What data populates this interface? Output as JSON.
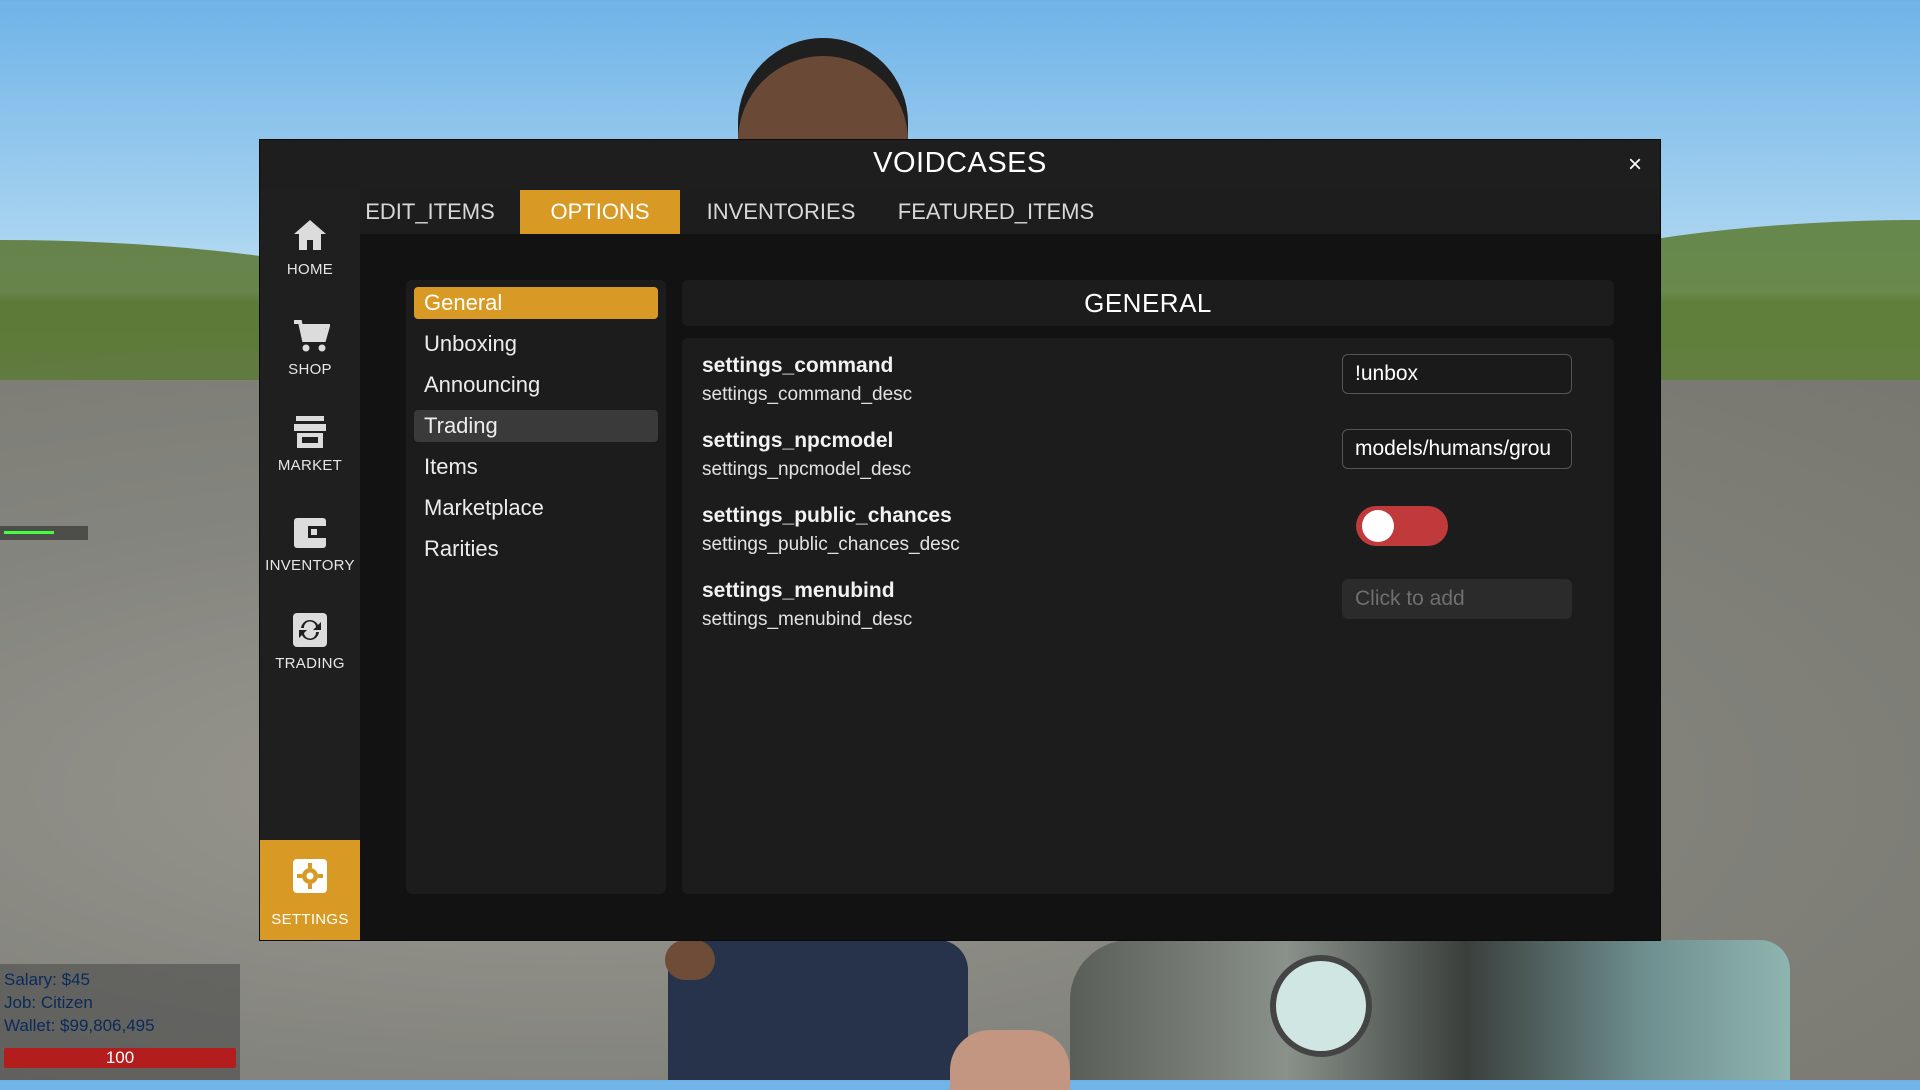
{
  "window": {
    "title": "VOIDCASES",
    "close_symbol": "×"
  },
  "sidebar": {
    "items": [
      {
        "label": "HOME",
        "icon": "home-icon"
      },
      {
        "label": "SHOP",
        "icon": "cart-icon"
      },
      {
        "label": "MARKET",
        "icon": "store-icon"
      },
      {
        "label": "INVENTORY",
        "icon": "wallet-icon"
      },
      {
        "label": "TRADING",
        "icon": "trade-icon"
      }
    ],
    "settings": {
      "label": "SETTINGS",
      "icon": "gear-icon"
    }
  },
  "tabs": [
    {
      "label": "EDIT_ITEMS"
    },
    {
      "label": "OPTIONS",
      "active": true
    },
    {
      "label": "INVENTORIES"
    },
    {
      "label": "FEATURED_ITEMS"
    }
  ],
  "categories": [
    {
      "label": "General",
      "state": "active"
    },
    {
      "label": "Unboxing"
    },
    {
      "label": "Announcing"
    },
    {
      "label": "Trading",
      "state": "hover"
    },
    {
      "label": "Items"
    },
    {
      "label": "Marketplace"
    },
    {
      "label": "Rarities"
    }
  ],
  "section": {
    "title": "GENERAL"
  },
  "settings": [
    {
      "name": "settings_command",
      "desc": "settings_command_desc",
      "value": "!unbox"
    },
    {
      "name": "settings_npcmodel",
      "desc": "settings_npcmodel_desc",
      "value": "models/humans/grou"
    },
    {
      "name": "settings_public_chances",
      "desc": "settings_public_chances_desc",
      "toggle": "off"
    },
    {
      "name": "settings_menubind",
      "desc": "settings_menubind_desc",
      "placeholder": "Click to add"
    }
  ],
  "hud": {
    "salary": "Salary: $45",
    "job": "Job: Citizen",
    "wallet": "Wallet: $99,806,495",
    "health": "100"
  },
  "colors": {
    "accent": "#d89a24",
    "toggle_off": "#c0393b",
    "panel": "#1c1c1c",
    "window_bg": "#121212"
  }
}
